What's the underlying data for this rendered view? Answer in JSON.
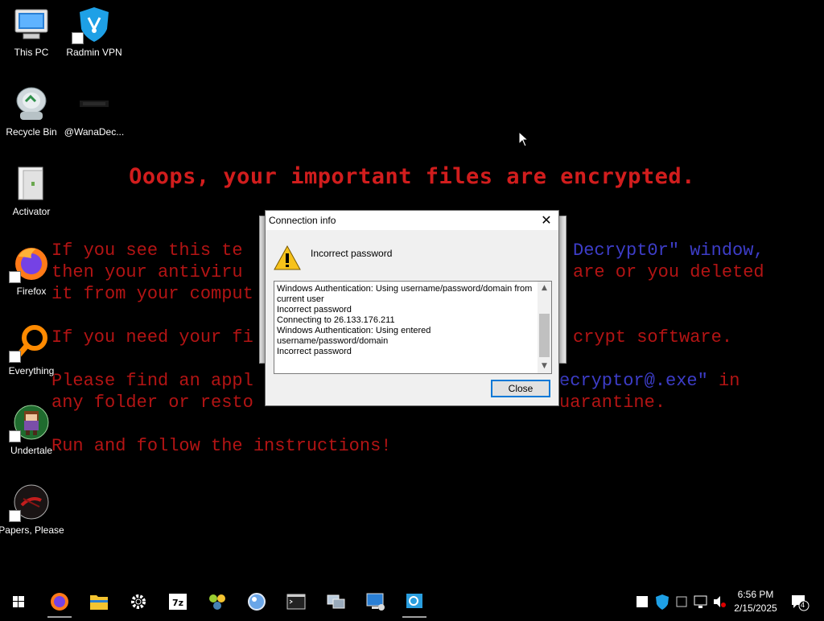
{
  "wallpaper": {
    "title": "Ooops, your important files are encrypted.",
    "lines": [
      {
        "a": "If you see this te",
        "b": "",
        "c": "Decrypt0r\" window,"
      },
      {
        "a": "then your antiviru",
        "b": "",
        "c": "are or you deleted"
      },
      {
        "a": "it from your comput",
        "b": "",
        "c": ""
      },
      {
        "a": "If you need your fi",
        "b": "",
        "c": "crypt software."
      },
      {
        "a": "Please find an appl",
        "b": "ecryptor@.exe\"",
        "c": " in"
      },
      {
        "a": "any folder or resto",
        "b": "",
        "c": "uarantine."
      },
      {
        "a": "Run and follow the instructions!",
        "b": "",
        "c": ""
      }
    ]
  },
  "desktop_icons": [
    {
      "label": "This PC",
      "icon": "this-pc-icon"
    },
    {
      "label": "Radmin VPN",
      "icon": "radmin-vpn-icon"
    },
    {
      "label": "Recycle Bin",
      "icon": "recycle-bin-icon"
    },
    {
      "label": "@WanaDec...",
      "icon": "wanadecryptor-icon"
    },
    {
      "label": "Activator",
      "icon": "activator-icon"
    },
    {
      "label": "Firefox",
      "icon": "firefox-icon"
    },
    {
      "label": "Everything",
      "icon": "everything-icon"
    },
    {
      "label": "Undertale",
      "icon": "undertale-icon"
    },
    {
      "label": "Papers, Please",
      "icon": "papers-please-icon"
    }
  ],
  "dialog": {
    "title": "Connection info",
    "message": "Incorrect password",
    "log": "Windows Authentication: Using username/password/domain from current user\nIncorrect password\nConnecting to 26.133.176.211\nWindows Authentication: Using entered username/password/domain\nIncorrect password",
    "close_label": "Close"
  },
  "taskbar": {
    "apps": [
      "start-icon",
      "firefox-icon",
      "file-explorer-icon",
      "settings-icon",
      "7zip-icon",
      "app-icon",
      "browser-app-icon",
      "terminal-icon",
      "network-tool-icon",
      "remote-desktop-icon",
      "radmin-viewer-icon"
    ],
    "time": "6:56 PM",
    "date": "2/15/2025",
    "notification_count": "4"
  },
  "colors": {
    "wallpaper_red": "#b31414",
    "wallpaper_blue": "#3d3dc8",
    "accent": "#0078d7"
  }
}
